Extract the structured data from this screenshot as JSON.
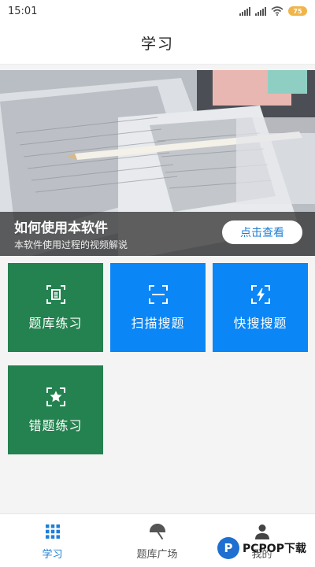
{
  "status": {
    "time": "15:01",
    "battery": "75"
  },
  "header": {
    "title": "学习"
  },
  "banner": {
    "title": "如何使用本软件",
    "subtitle": "本软件使用过程的视频解说",
    "button": "点击查看"
  },
  "tiles": [
    {
      "label": "题库练习",
      "icon": "document-scan-icon",
      "color": "#23824f"
    },
    {
      "label": "扫描搜题",
      "icon": "scan-frame-icon",
      "color": "#0a86f6"
    },
    {
      "label": "快搜搜题",
      "icon": "flash-scan-icon",
      "color": "#0a86f6"
    },
    {
      "label": "错题练习",
      "icon": "star-scan-icon",
      "color": "#23824f"
    }
  ],
  "tabs": [
    {
      "label": "学习",
      "icon": "grid-icon",
      "active": true
    },
    {
      "label": "题库广场",
      "icon": "umbrella-icon",
      "active": false
    },
    {
      "label": "我的",
      "icon": "person-icon",
      "active": false
    }
  ],
  "watermark": {
    "logo": "P",
    "text": "PCPOP下载"
  }
}
